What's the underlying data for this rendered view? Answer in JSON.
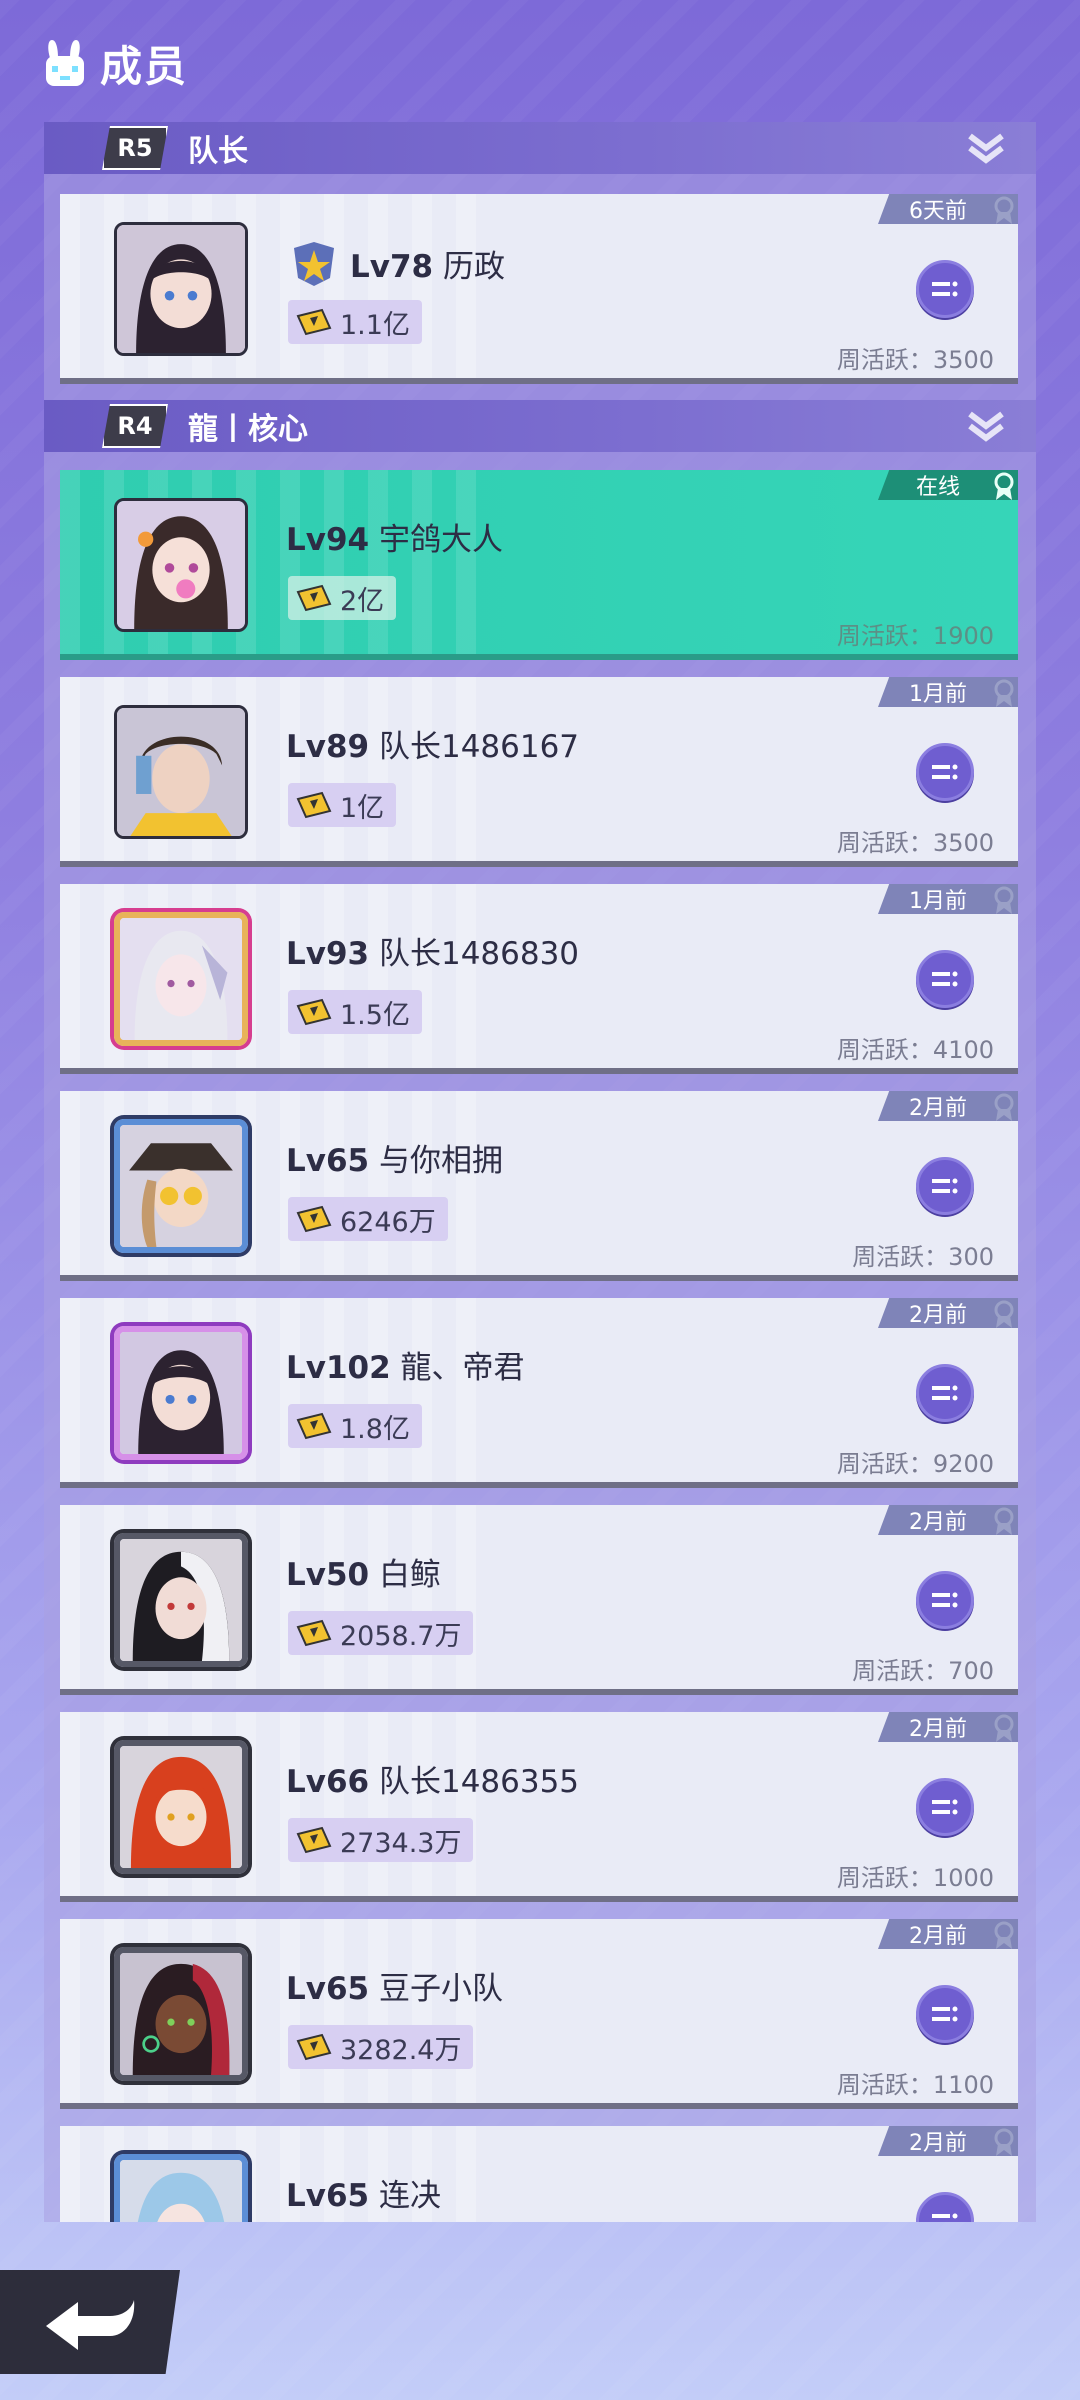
{
  "header": {
    "title": "成员",
    "icon": "bunny-icon"
  },
  "sections": [
    {
      "rank": "R5",
      "name": "队长"
    },
    {
      "rank": "R4",
      "name": "龍丨核心"
    }
  ],
  "members": [
    {
      "level": "Lv78",
      "name": "历政",
      "power": "1.1亿",
      "time": "6天前",
      "activity": "周活跃：3500",
      "online": false
    },
    {
      "level": "Lv94",
      "name": "宇鸽大人",
      "power": "2亿",
      "time": "在线",
      "activity": "周活跃：1900",
      "online": true
    },
    {
      "level": "Lv89",
      "name": "队长1486167",
      "power": "1亿",
      "time": "1月前",
      "activity": "周活跃：3500",
      "online": false
    },
    {
      "level": "Lv93",
      "name": "队长1486830",
      "power": "1.5亿",
      "time": "1月前",
      "activity": "周活跃：4100",
      "online": false
    },
    {
      "level": "Lv65",
      "name": "与你相拥",
      "power": "6246万",
      "time": "2月前",
      "activity": "周活跃：300",
      "online": false
    },
    {
      "level": "Lv102",
      "name": "龍、帝君",
      "power": "1.8亿",
      "time": "2月前",
      "activity": "周活跃：9200",
      "online": false
    },
    {
      "level": "Lv50",
      "name": "白鲸",
      "power": "2058.7万",
      "time": "2月前",
      "activity": "周活跃：700",
      "online": false
    },
    {
      "level": "Lv66",
      "name": "队长1486355",
      "power": "2734.3万",
      "time": "2月前",
      "activity": "周活跃：1000",
      "online": false
    },
    {
      "level": "Lv65",
      "name": "豆子小队",
      "power": "3282.4万",
      "time": "2月前",
      "activity": "周活跃：1100",
      "online": false
    },
    {
      "level": "Lv65",
      "name": "连决",
      "power": "",
      "time": "2月前",
      "activity": "",
      "online": false
    }
  ],
  "colors": {
    "accent": "#6f5ed0",
    "online": "#36d5b8",
    "card": "#e9ebf6"
  }
}
